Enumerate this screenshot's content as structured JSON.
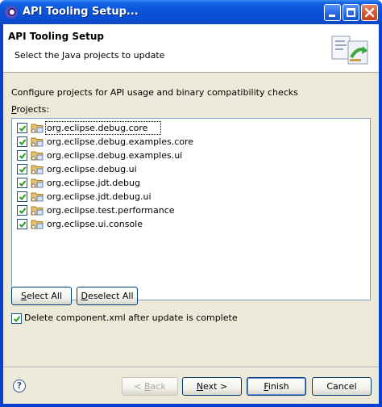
{
  "window": {
    "title": "API Tooling Setup..."
  },
  "header": {
    "title": "API Tooling Setup",
    "message": "Select the Java projects to update"
  },
  "description": "Configure projects for API usage and binary compatibility checks",
  "projects_label": {
    "mnemonic": "P",
    "rest": "rojects:"
  },
  "projects": [
    {
      "label": "org.eclipse.debug.core",
      "checked": true
    },
    {
      "label": "org.eclipse.debug.examples.core",
      "checked": true
    },
    {
      "label": "org.eclipse.debug.examples.ui",
      "checked": true
    },
    {
      "label": "org.eclipse.debug.ui",
      "checked": true
    },
    {
      "label": "org.eclipse.jdt.debug",
      "checked": true
    },
    {
      "label": "org.eclipse.jdt.debug.ui",
      "checked": true
    },
    {
      "label": "org.eclipse.test.performance",
      "checked": true
    },
    {
      "label": "org.eclipse.ui.console",
      "checked": true
    }
  ],
  "buttons": {
    "select_all": {
      "mnemonic": "S",
      "rest": "elect All"
    },
    "deselect_all": {
      "mnemonic": "D",
      "rest": "eselect All"
    },
    "back": {
      "lead": "< ",
      "mnemonic": "B",
      "rest": "ack"
    },
    "next": {
      "mnemonic": "N",
      "rest": "ext >"
    },
    "finish": {
      "mnemonic": "F",
      "rest": "inish"
    },
    "cancel": "Cancel"
  },
  "delete_option": {
    "label": "Delete component.xml after update is complete",
    "checked": true
  },
  "help_glyph": "?",
  "icons": [
    "eclipse-icon",
    "minimize-icon",
    "maximize-icon",
    "close-icon",
    "wizard-banner-icon",
    "package-folder-icon",
    "help-icon"
  ],
  "colors": {
    "title_bar": "#0a4fd4",
    "dialog_bg": "#ece9d8",
    "check_mark": "#21a121"
  }
}
